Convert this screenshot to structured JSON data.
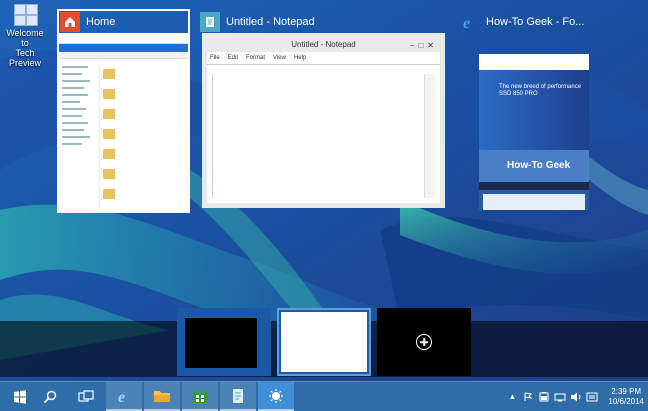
{
  "desktop": {
    "icons": [
      {
        "label_line1": "Welcome to",
        "label_line2": "Tech Preview"
      }
    ]
  },
  "task_view": {
    "windows": [
      {
        "title": "Home",
        "icon": "home-folder-icon",
        "selected": true
      },
      {
        "title": "Untitled - Notepad",
        "icon": "notepad-icon",
        "selected": false
      },
      {
        "title": "How-To Geek - Fo...",
        "icon": "internet-explorer-icon",
        "selected": false
      }
    ],
    "notepad": {
      "window_title": "Untitled - Notepad",
      "menu": [
        "File",
        "Edit",
        "Format",
        "View",
        "Help"
      ]
    },
    "browser": {
      "ad_line1": "The new breed of performance",
      "ad_line2": "SSD 850 PRO",
      "site_name": "How-To Geek"
    },
    "explorer": {
      "title": "Home"
    }
  },
  "virtual_desktops": {
    "desktops": [
      {
        "name": "desktop-1"
      },
      {
        "name": "desktop-2"
      }
    ],
    "add_icon": "plus-icon"
  },
  "taskbar": {
    "start_icon": "windows-logo-icon",
    "search_icon": "search-icon",
    "task_view_icon": "task-view-icon",
    "pinned": [
      {
        "name": "internet-explorer-icon"
      },
      {
        "name": "file-explorer-icon"
      },
      {
        "name": "store-icon"
      },
      {
        "name": "notepad-icon"
      },
      {
        "name": "weather-app-icon"
      }
    ],
    "tray_icons": [
      "chevron-up-icon",
      "flag-icon",
      "battery-icon",
      "network-icon",
      "volume-icon",
      "language-icon"
    ],
    "clock": {
      "time": "2:39 PM",
      "date": "10/6/2014"
    }
  },
  "colors": {
    "taskbar": "#2e6da8",
    "home_badge": "#e44c2c",
    "notepad_badge": "#4aa8c5",
    "ie_badge": "#2f9bd8"
  }
}
